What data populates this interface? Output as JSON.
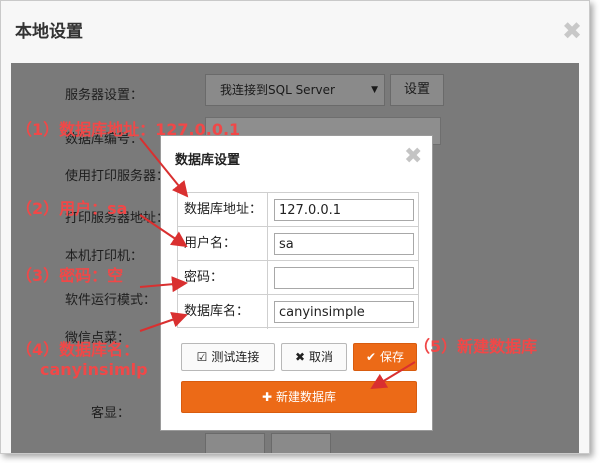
{
  "window": {
    "title": "本地设置"
  },
  "background_form": {
    "server_settings_label": "服务器设置：",
    "server_select_value": "我连接到SQL Server",
    "settings_button": "设置",
    "db_number_label": "数据库编号：",
    "use_print_server_label": "使用打印服务器：",
    "print_server_address_label": "打印服务器地址：",
    "local_printer_label": "本机打印机：",
    "software_mode_label": "软件运行模式：",
    "wechat_order_label": "微信点菜：",
    "customer_display_label": "客显："
  },
  "dialog": {
    "title": "数据库设置",
    "rows": [
      {
        "label": "数据库地址：",
        "value": "127.0.0.1"
      },
      {
        "label": "用户名：",
        "value": "sa"
      },
      {
        "label": "密码：",
        "value": ""
      },
      {
        "label": "数据库名：",
        "value": "canyinsimple"
      }
    ],
    "test_button": "测试连接",
    "cancel_button": "取消",
    "save_button": "保存",
    "new_db_button": "新建数据库"
  },
  "annotations": [
    "（1）数据库地址：127.0.0.1",
    "（2）用户：sa",
    "（3）密码：空",
    "（4）数据库名：",
    "canyinsimlp",
    "（5）新建数据库"
  ],
  "colors": {
    "accent": "#ec6a17",
    "annotation": "#f04848",
    "overlay": "#7a7a7a"
  }
}
